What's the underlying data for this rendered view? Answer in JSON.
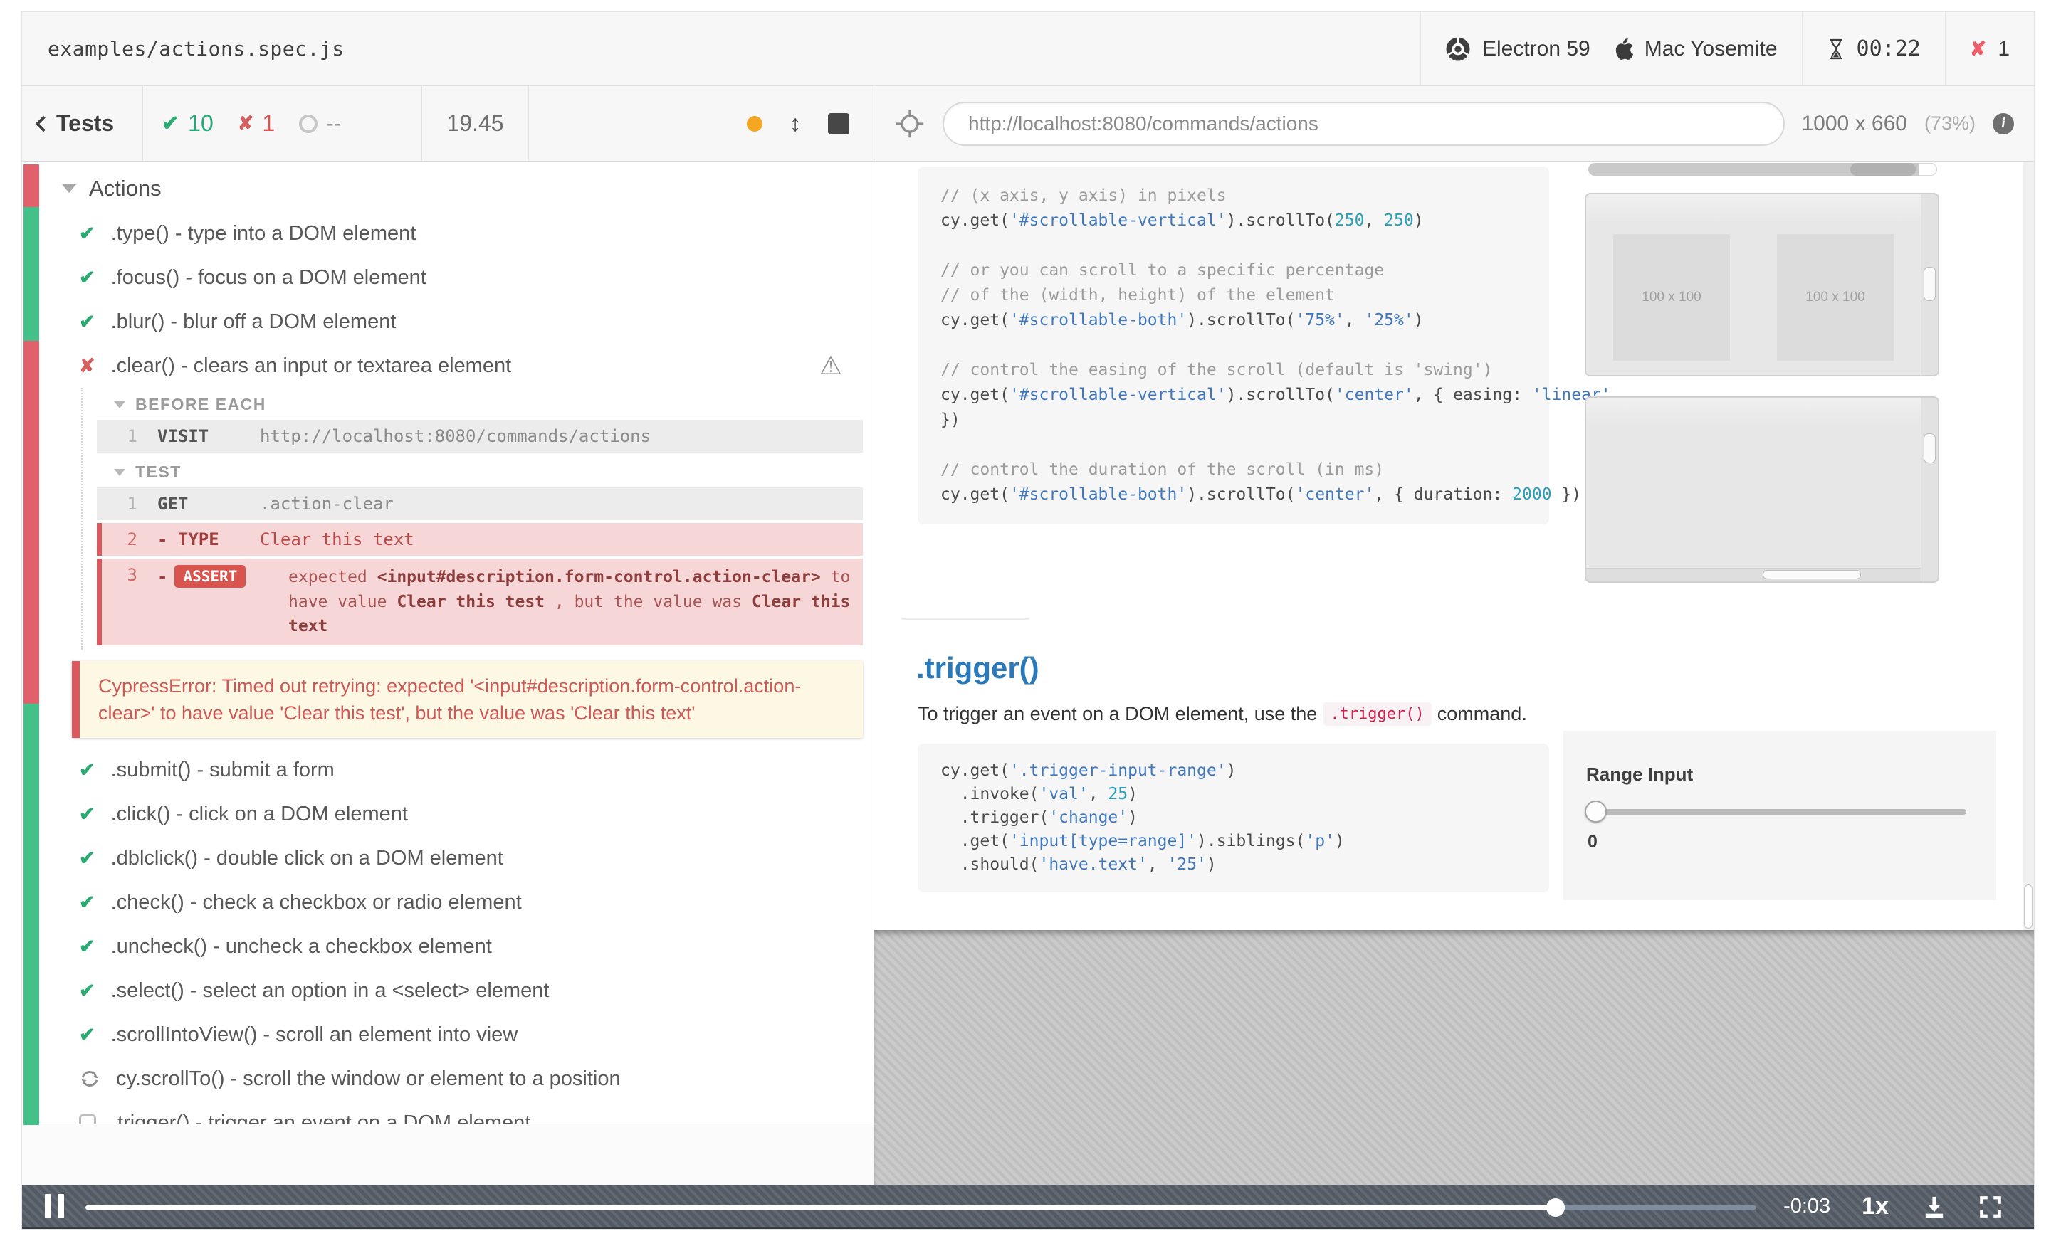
{
  "colors": {
    "pass_green": "#2bab72",
    "fail_red": "#d9534f",
    "strip_green": "#43c189",
    "strip_red": "#e2606b",
    "link_blue": "#2a7ab9",
    "pending_gray": "#9a9a9a"
  },
  "header": {
    "spec_title": "examples/actions.spec.js",
    "browser": "Electron 59",
    "os": "Mac Yosemite",
    "timer": "00:22",
    "failure_count": "1"
  },
  "toolbar": {
    "back_label": "Tests",
    "passed_count": "10",
    "failed_count": "1",
    "pending_count": "--",
    "duration": "19.45",
    "url": "http://localhost:8080/commands/actions",
    "viewport_size": "1000 x 660",
    "viewport_zoom": "(73%)"
  },
  "command_log": {
    "suite_title": "Actions",
    "tests_before": [
      ".type() - type into a DOM element",
      ".focus() - focus on a DOM element",
      ".blur() - blur off a DOM element",
      ".clear() - clears an input or textarea element"
    ],
    "hooks": {
      "before_each_label": "BEFORE EACH",
      "test_label": "TEST",
      "visit_row": {
        "num": "1",
        "cmd": "VISIT",
        "value": "http://localhost:8080/commands/actions"
      },
      "get_row": {
        "num": "1",
        "cmd": "GET",
        "value": ".action-clear"
      },
      "type_row": {
        "num": "2",
        "cmd": "- TYPE",
        "value": "Clear this text"
      },
      "assert_row": {
        "num": "3",
        "dash": "-",
        "badge": "ASSERT",
        "p1": "expected ",
        "code": "<input#description.form-control.action-clear>",
        "p2": " to have value ",
        "expected": "Clear this test",
        "p3": " , but the value was ",
        "actual": "Clear this text"
      }
    },
    "error_message": "CypressError: Timed out retrying: expected '<input#description.form-control.action-clear>' to have value 'Clear this test', but the value was 'Clear this text'",
    "tests_after": [
      ".submit() - submit a form",
      ".click() - click on a DOM element",
      ".dblclick() - double click on a DOM element",
      ".check() - check a checkbox or radio element",
      ".uncheck() - uncheck a checkbox element",
      ".select() - select an option in a <select> element",
      ".scrollIntoView() - scroll an element into view",
      "cy.scrollTo() - scroll the window or element to a position",
      ".trigger() - trigger an event on a DOM element"
    ]
  },
  "preview": {
    "code_scroll_lines": [
      "// (x axis, y axis) in pixels",
      "cy.get('#scrollable-vertical').scrollTo(250, 250)",
      "",
      "// or you can scroll to a specific percentage",
      "// of the (width, height) of the element",
      "cy.get('#scrollable-both').scrollTo('75%', '25%')",
      "",
      "// control the easing of the scroll (default is 'swing')",
      "cy.get('#scrollable-vertical').scrollTo('center', { easing: 'linear'",
      "})",
      "",
      "// control the duration of the scroll (in ms)",
      "cy.get('#scrollable-both').scrollTo('center', { duration: 2000 })"
    ],
    "section_title": ".trigger()",
    "desc_pre": "To trigger an event on a DOM element, use the",
    "desc_code": ".trigger()",
    "desc_post": "command.",
    "code_trigger_lines": [
      "cy.get('.trigger-input-range')",
      "  .invoke('val', 25)",
      "  .trigger('change')",
      "  .get('input[type=range]').siblings('p')",
      "  .should('have.text', '25')"
    ],
    "placeholders": [
      "100 x 100",
      "100 x 100"
    ],
    "range_label": "Range Input",
    "range_value": "0"
  },
  "player": {
    "time_remaining": "-0:03",
    "speed": "1x"
  }
}
